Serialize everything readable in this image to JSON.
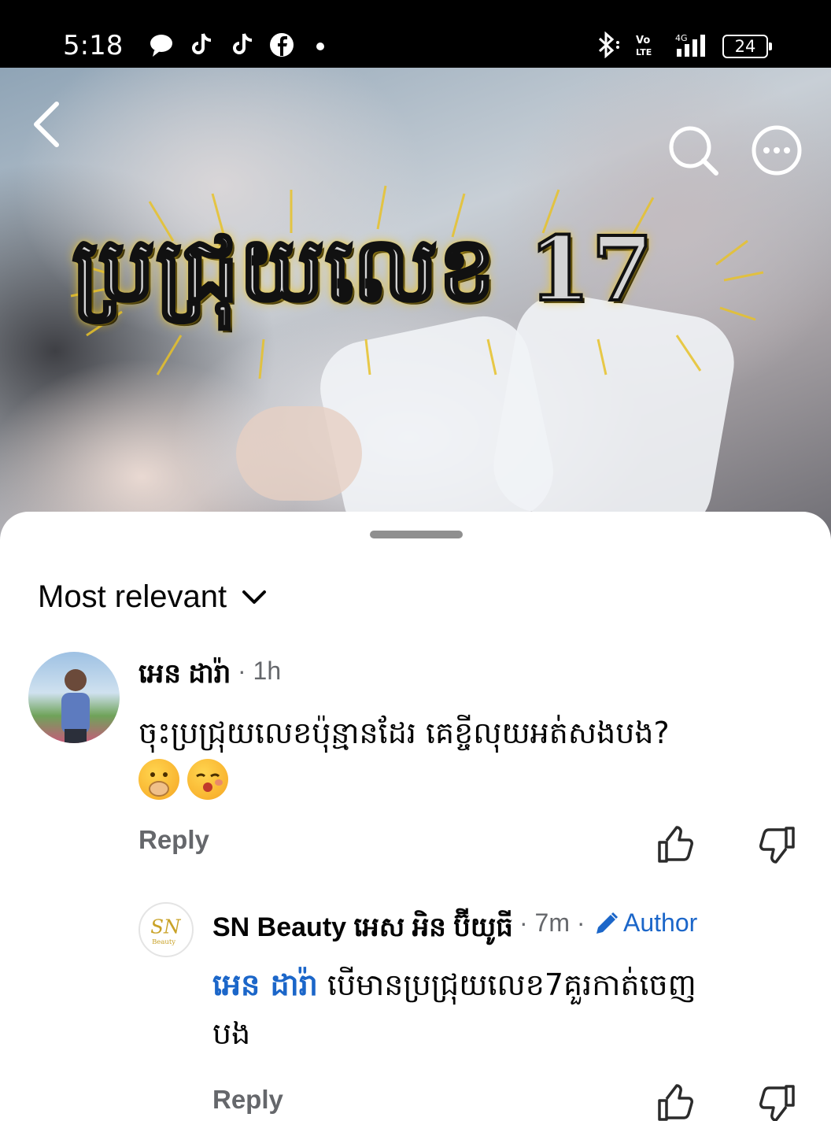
{
  "status_bar": {
    "time": "5:18",
    "battery": "24",
    "network_label": "4G"
  },
  "media": {
    "title_overlay": "ប្រជ្រុយលេខ 17"
  },
  "comments_sheet": {
    "sort_label": "Most relevant",
    "comments": [
      {
        "author": "អេន ដារ៉ា",
        "time": "· 1h",
        "text_line1": "ចុះប្រជ្រុយលេខប៉ុន្មានដែរ គេខ្ចីលុយអត់សងបង?",
        "reply_label": "Reply"
      },
      {
        "author": "SN Beauty អេស អិន ប៊ីយូធី",
        "time": "· 7m ·",
        "author_badge": "Author",
        "avatar_text": "SN",
        "avatar_sub": "Beauty",
        "mention": "អេន ដារ៉ា",
        "text_line1": " បើមានប្រជ្រុយលេខ7គួរកាត់ចេញ",
        "text_line2": "បង",
        "reply_label": "Reply"
      }
    ]
  },
  "colors": {
    "link_blue": "#1b66c9",
    "meta_gray": "#65676b"
  }
}
